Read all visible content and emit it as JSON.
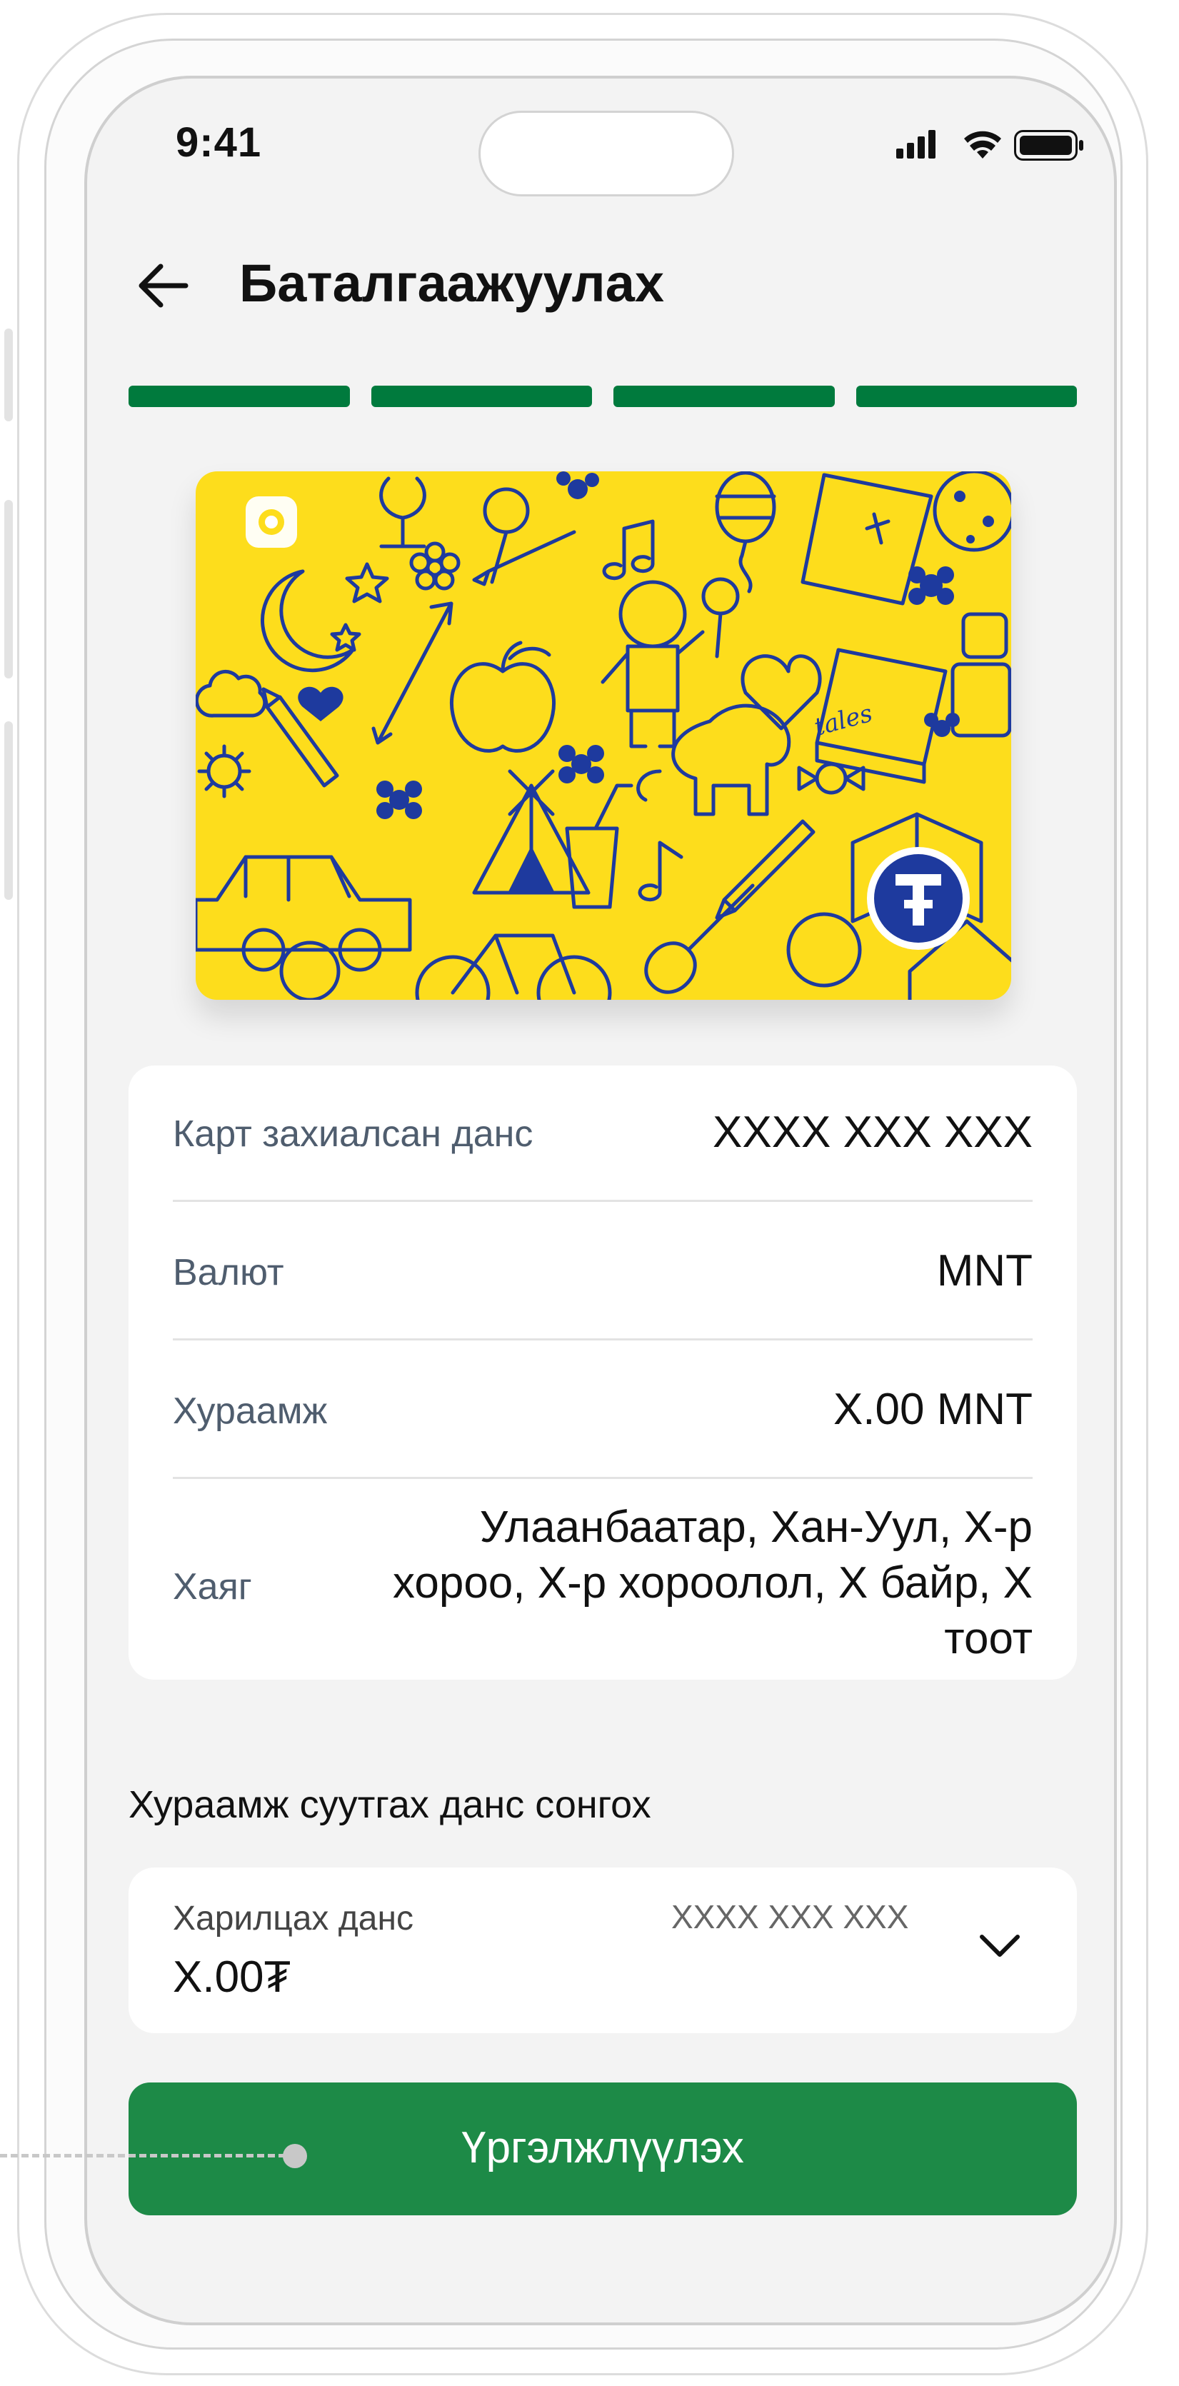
{
  "status_bar": {
    "time": "9:41"
  },
  "header": {
    "title": "Баталгаажуулах"
  },
  "progress": {
    "total_steps": 4,
    "completed_steps": 4,
    "color": "#007a3d"
  },
  "card": {
    "background_color": "#fddd1c",
    "artwork_color": "#1e3a9e",
    "book_text": "tales"
  },
  "details": {
    "rows": [
      {
        "label": "Карт захиалсан данс",
        "value": "XXXX XXX XXX"
      },
      {
        "label": "Валют",
        "value": "MNT"
      },
      {
        "label": "Хураамж",
        "value": "X.00 MNT"
      },
      {
        "label": "Хаяг",
        "value_lines": [
          "Улаанбаатар, Хан-Уул, X-р",
          "хороо, X-р хороолол, X байр, X",
          "тоот"
        ]
      }
    ]
  },
  "fee_account": {
    "section_title": "Хураамж суутгах данс сонгох",
    "account_type": "Харилцах данс",
    "account_number": "XXXX XXX XXX",
    "balance": "X.00₮"
  },
  "actions": {
    "continue_label": "Үргэлжлүүлэх",
    "color": "#1d8a47"
  },
  "icons": [
    "back-arrow-icon",
    "signal-icon",
    "wifi-icon",
    "battery-icon",
    "chevron-down-icon",
    "card-logo-icon",
    "bank-logo-icon"
  ]
}
